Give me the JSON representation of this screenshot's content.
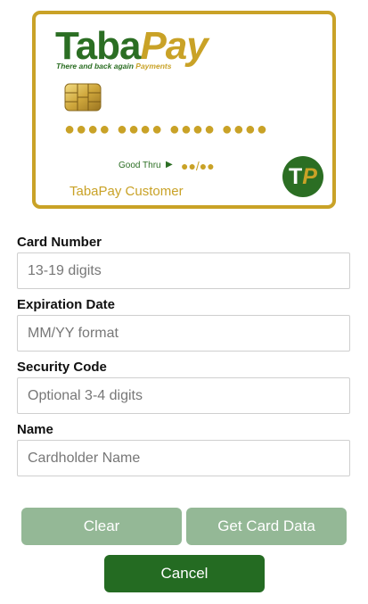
{
  "card": {
    "brand_part1": "Taba",
    "brand_part2": "Pay",
    "tagline_part1": "There and back again ",
    "tagline_part2": "Payments",
    "number_mask": "●●●● ●●●● ●●●● ●●●●",
    "good_thru_label": "Good Thru",
    "good_thru_arrow": "▶",
    "expiry_mask": "●●/●●",
    "holder": "TabaPay Customer",
    "badge_t": "T",
    "badge_p": "P"
  },
  "form": {
    "card_number": {
      "label": "Card Number",
      "placeholder": "13-19 digits",
      "value": ""
    },
    "expiration": {
      "label": "Expiration Date",
      "placeholder": "MM/YY format",
      "value": ""
    },
    "security_code": {
      "label": "Security Code",
      "placeholder": "Optional 3-4 digits",
      "value": ""
    },
    "name": {
      "label": "Name",
      "placeholder": "Cardholder Name",
      "value": ""
    }
  },
  "buttons": {
    "clear": "Clear",
    "get_card_data": "Get Card Data",
    "cancel": "Cancel"
  },
  "colors": {
    "brand_green": "#2b6e23",
    "brand_gold": "#c9a227",
    "button_disabled": "#94b896",
    "button_primary": "#246b22"
  },
  "icons": {
    "chip": "card-chip-icon",
    "badge": "tp-badge-icon",
    "arrow": "triangle-right-icon"
  }
}
